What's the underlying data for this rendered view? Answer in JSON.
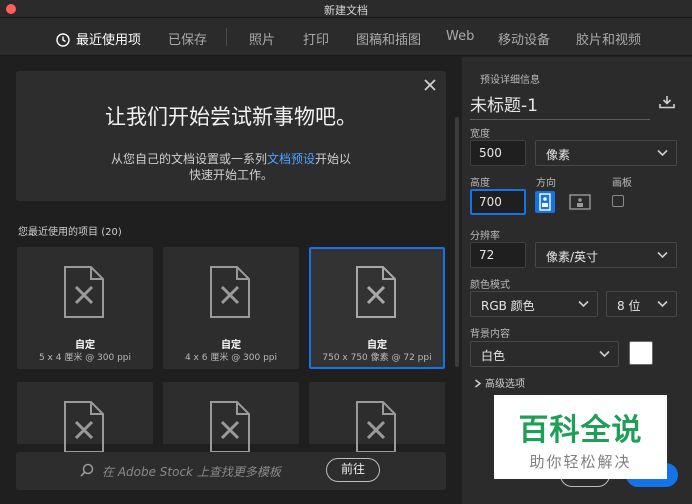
{
  "window": {
    "title": "新建文档"
  },
  "tabs": [
    {
      "label": "最近使用项"
    },
    {
      "label": "已保存"
    },
    {
      "label": "照片"
    },
    {
      "label": "打印"
    },
    {
      "label": "图稿和插图"
    },
    {
      "label": "Web"
    },
    {
      "label": "移动设备"
    },
    {
      "label": "胶片和视频"
    }
  ],
  "hero": {
    "headline": "让我们开始尝试新事物吧。",
    "line1_prefix": "从您自己的文档设置或一系列",
    "line1_link": "文档预设",
    "line1_suffix": "开始以",
    "line2": "快速开始工作。"
  },
  "recent": {
    "label": "您最近使用的项目",
    "count": "(20)",
    "items": [
      {
        "name": "自定",
        "meta": "5 x 4 厘米 @ 300 ppi"
      },
      {
        "name": "自定",
        "meta": "4 x 6 厘米 @ 300 ppi"
      },
      {
        "name": "自定",
        "meta": "750 x 750 像素 @ 72 ppi"
      }
    ]
  },
  "search": {
    "placeholder": "在 Adobe Stock 上查找更多模板",
    "go_label": "前往"
  },
  "details": {
    "section_label": "预设详细信息",
    "doc_title": "未标题-1",
    "width_label": "宽度",
    "width_value": "500",
    "width_unit": "像素",
    "height_label": "高度",
    "height_value": "700",
    "orientation_label": "方向",
    "artboard_label": "画板",
    "resolution_label": "分辨率",
    "resolution_value": "72",
    "resolution_unit": "像素/英寸",
    "color_mode_label": "颜色模式",
    "color_mode_value": "RGB 颜色",
    "bit_depth_value": "8 位",
    "background_label": "背景内容",
    "background_value": "白色",
    "advanced_label": "高级选项"
  },
  "watermark": {
    "big": "百科全说",
    "small": "助你轻松解决"
  },
  "colors": {
    "accent": "#1473e6",
    "panel": "#2b2b2b",
    "background": "#1f1f1f",
    "watermark_green": "#1e9e57"
  },
  "icons": [
    "clock-icon",
    "close-icon",
    "document-icon",
    "search-icon",
    "save-preset-icon",
    "chevron-down-icon",
    "portrait-icon",
    "landscape-icon",
    "chevron-right-icon"
  ]
}
